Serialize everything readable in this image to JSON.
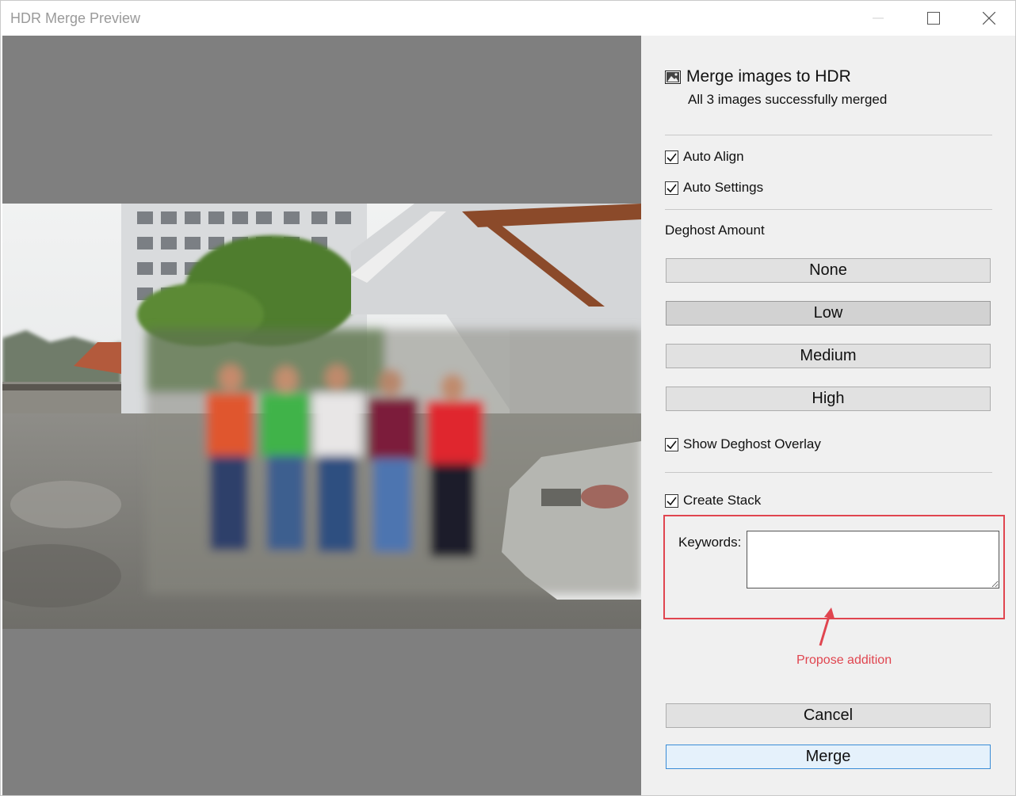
{
  "window": {
    "title": "HDR Merge Preview",
    "controls": [
      "minimize",
      "maximize",
      "close"
    ]
  },
  "preview": {
    "background_color": "#7f7f7f",
    "image_description_icon": "photo-preview"
  },
  "panel": {
    "title": "Merge images to HDR",
    "subtitle": "All 3 images successfully merged",
    "icon": "hdr-image-icon",
    "checkboxes": {
      "auto_align": {
        "label": "Auto Align",
        "checked": true
      },
      "auto_settings": {
        "label": "Auto Settings",
        "checked": true
      },
      "show_deghost_overlay": {
        "label": "Show Deghost Overlay",
        "checked": true
      },
      "create_stack": {
        "label": "Create Stack",
        "checked": true
      }
    },
    "deghost": {
      "label": "Deghost Amount",
      "options": [
        "None",
        "Low",
        "Medium",
        "High"
      ],
      "selected": "Low"
    },
    "keywords": {
      "label": "Keywords:",
      "value": ""
    },
    "annotation": {
      "text": "Propose addition",
      "color": "#e0454f"
    },
    "actions": {
      "cancel": "Cancel",
      "merge": "Merge"
    }
  }
}
